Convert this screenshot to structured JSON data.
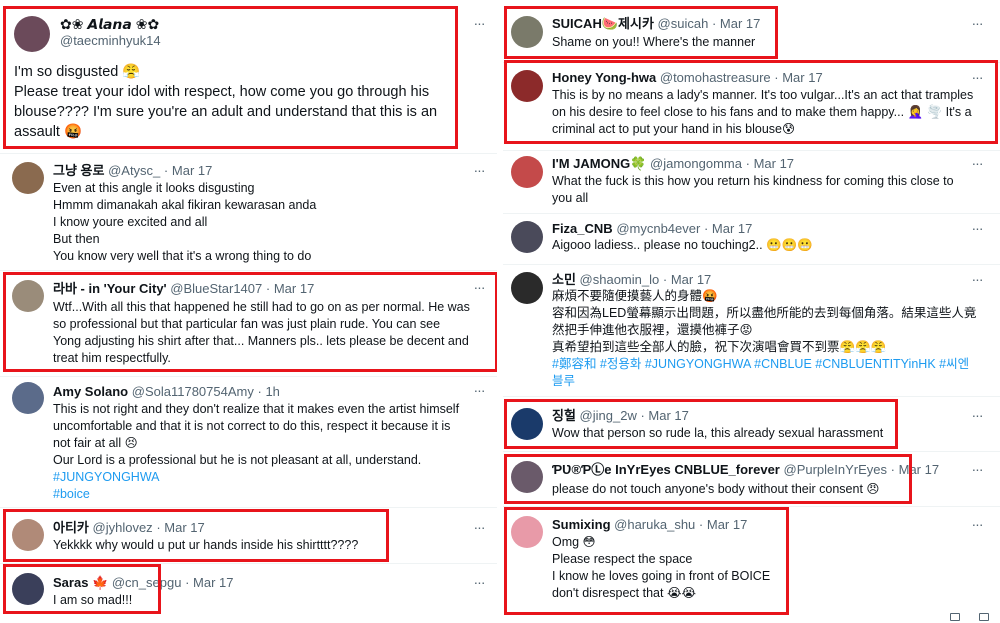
{
  "ui": {
    "more_glyph": "···",
    "dot": "·"
  },
  "colors": {
    "highlight": "#e8141b",
    "link": "#1d9bf0",
    "muted": "#536471"
  },
  "left": [
    {
      "name": "✿❀ 𝘼𝙡𝙖𝙣𝙖 ❀✿",
      "handle": "@taecminhyuk14",
      "time": "",
      "emoji": "",
      "lines": [
        "I'm so disgusted 😤",
        "Please treat your idol with respect, how come you go through his",
        "blouse???? I'm sure you're an adult and understand that this is an",
        "assault 🤬"
      ],
      "avatar_color": "#6b4a5a"
    },
    {
      "name": "그냥 용로",
      "handle": "@Atysc_",
      "time": "Mar 17",
      "emoji": "",
      "lines": [
        "Even at this angle it looks disgusting",
        "Hmmm dimanakah akal fikiran kewarasan anda",
        "I know youre excited and all",
        "But then",
        "You know very well that it's a wrong thing to do"
      ],
      "avatar_color": "#8a6a4f"
    },
    {
      "name": "라바 - in 'Your City'",
      "handle": "@BlueStar1407",
      "time": "Mar 17",
      "emoji": "",
      "lines": [
        "Wtf...With all this that happened he still had to go on as per normal. He was",
        "so professional but  that particular fan was just plain rude.  You can see",
        "Yong adjusting his shirt after that... Manners  pls.. lets please be decent and",
        "treat him respectfully."
      ],
      "avatar_color": "#9a8c7a"
    },
    {
      "name": "Amy Solano",
      "handle": "@Sola11780754Amy",
      "time": "1h",
      "emoji": "",
      "lines": [
        "This is not right and they don't realize that it makes even the artist himself",
        "uncomfortable and that it is not correct to do this, respect it because it is",
        "not fair at all 😣",
        "Our Lord is a professional but he is not pleasant at all, understand."
      ],
      "tags": [
        "#JUNGYONGHWA",
        "#boice"
      ],
      "avatar_color": "#5b6b8a"
    },
    {
      "name": "아티카",
      "handle": "@jyhlovez",
      "time": "Mar 17",
      "emoji": "",
      "lines": [
        "Yekkkk why would u put ur hands inside his shirtttt????"
      ],
      "avatar_color": "#b08a78"
    },
    {
      "name": "Saras",
      "handle": "@cn_sepgu",
      "time": "Mar 17",
      "emoji": "🍁",
      "lines": [
        "I am so mad!!!"
      ],
      "avatar_color": "#3a3f5a"
    }
  ],
  "right": [
    {
      "name": "SUICAH🍉제시카",
      "handle": "@suicah",
      "time": "Mar 17",
      "lines": [
        "Shame on you!! Where's the manner"
      ],
      "avatar_color": "#7a7a6a"
    },
    {
      "name": "Honey Yong-hwa",
      "handle": "@tomohastreasure",
      "time": "Mar 17",
      "lines": [
        "This is by no means a lady's manner. It's too vulgar...It's an act that tramples",
        "on his desire to feel close to his fans and to make them happy... 🤦‍♀️ 🌪️ It's a",
        "criminal act to put your hand in his blouse😰"
      ],
      "avatar_color": "#8c2a2a"
    },
    {
      "name": "I'M JAMONG🍀",
      "handle": "@jamongomma",
      "time": "Mar 17",
      "lines": [
        "What the fuck is this how you return his kindness for coming this close to",
        "you all"
      ],
      "avatar_color": "#c44a4a"
    },
    {
      "name": "Fiza_CNB",
      "handle": "@mycnb4ever",
      "time": "Mar 17",
      "lines": [
        "Aigooo ladiess.. please no touching2.. 😬😬😬"
      ],
      "avatar_color": "#4a4a5a"
    },
    {
      "name": "소민",
      "handle": "@shaomin_lo",
      "time": "Mar 17",
      "lines": [
        "麻煩不要隨便摸藝人的身體🤬",
        "容和因為LED螢幕顯示出問題，所以盡他所能的去到每個角落。結果這些人竟",
        "然把手伸進他衣服裡，還摸他褲子😡",
        "真希望拍到這些全部人的臉，祝下次演唱會買不到票😤😤😤"
      ],
      "tags": [
        "#鄭容和 #정용화 #JUNGYONGHWA #CNBLUE #CNBLUENTITYinHK #씨엔",
        "블루"
      ],
      "avatar_color": "#2a2a2a"
    },
    {
      "name": "징헐",
      "handle": "@jing_2w",
      "time": "Mar 17",
      "lines": [
        "Wow that person so rude la, this already sexual harassment"
      ],
      "avatar_color": "#1a3a6a"
    },
    {
      "name": "ƤƲ®ƤⓁe InYrEyes CNBLUE_forever",
      "handle": "@PurpleInYrEyes",
      "time": "Mar 17",
      "lines": [
        "please do not touch anyone's body without their consent 😠"
      ],
      "avatar_color": "#6a5a6a"
    },
    {
      "name": "Sumixing",
      "handle": "@haruka_shu",
      "time": "Mar 17",
      "lines": [
        "Omg 😳",
        "Please respect the space",
        "I know he loves going in front of BOICE",
        "don't disrespect that 😭😭"
      ],
      "avatar_color": "#e89aa8"
    }
  ]
}
